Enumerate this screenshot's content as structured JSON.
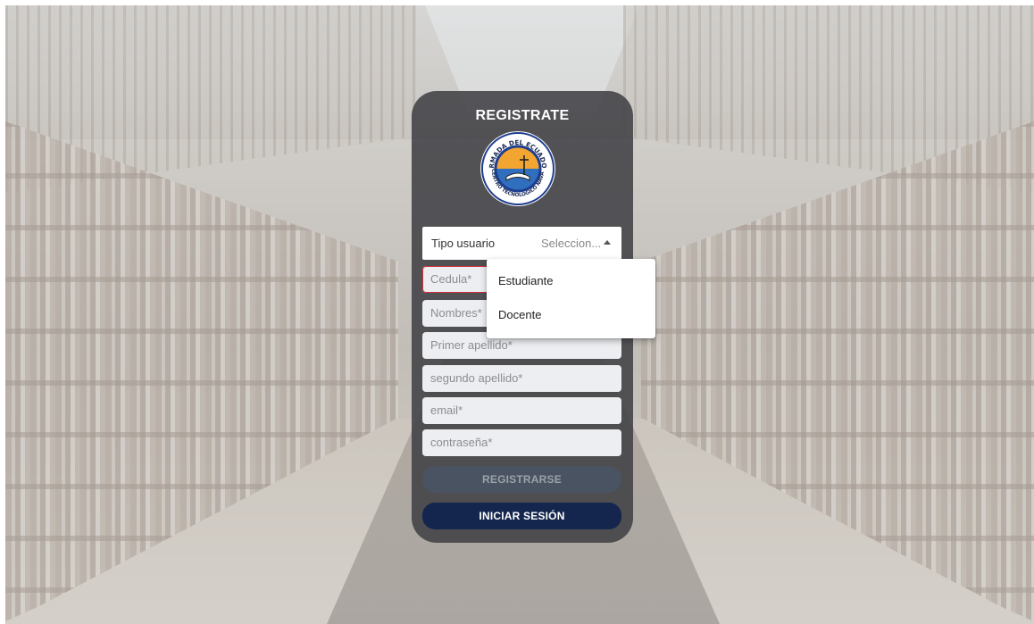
{
  "form": {
    "title": "REGISTRATE",
    "logo": {
      "top_text": "ARMADA DEL ECUADOR",
      "bottom_text": "CENTRO TECNOLOGICO NAVAL"
    },
    "user_type": {
      "label": "Tipo usuario",
      "value": "Seleccion...",
      "options": [
        "Estudiante",
        "Docente"
      ]
    },
    "fields": {
      "cedula": "Cedula*",
      "nombres": "Nombres*",
      "primer_apellido": "Primer apellido*",
      "segundo_apellido": "segundo apellido*",
      "email": "email*",
      "contrasena": "contraseña*"
    },
    "buttons": {
      "register": "REGISTRARSE",
      "login": "INICIAR SESIÓN"
    }
  },
  "colors": {
    "card_bg": "#3e3e42",
    "login_button": "#14264d",
    "error_border": "#d0303a",
    "logo_ring_outer": "#1f3e8f",
    "logo_sun": "#f2a531"
  }
}
